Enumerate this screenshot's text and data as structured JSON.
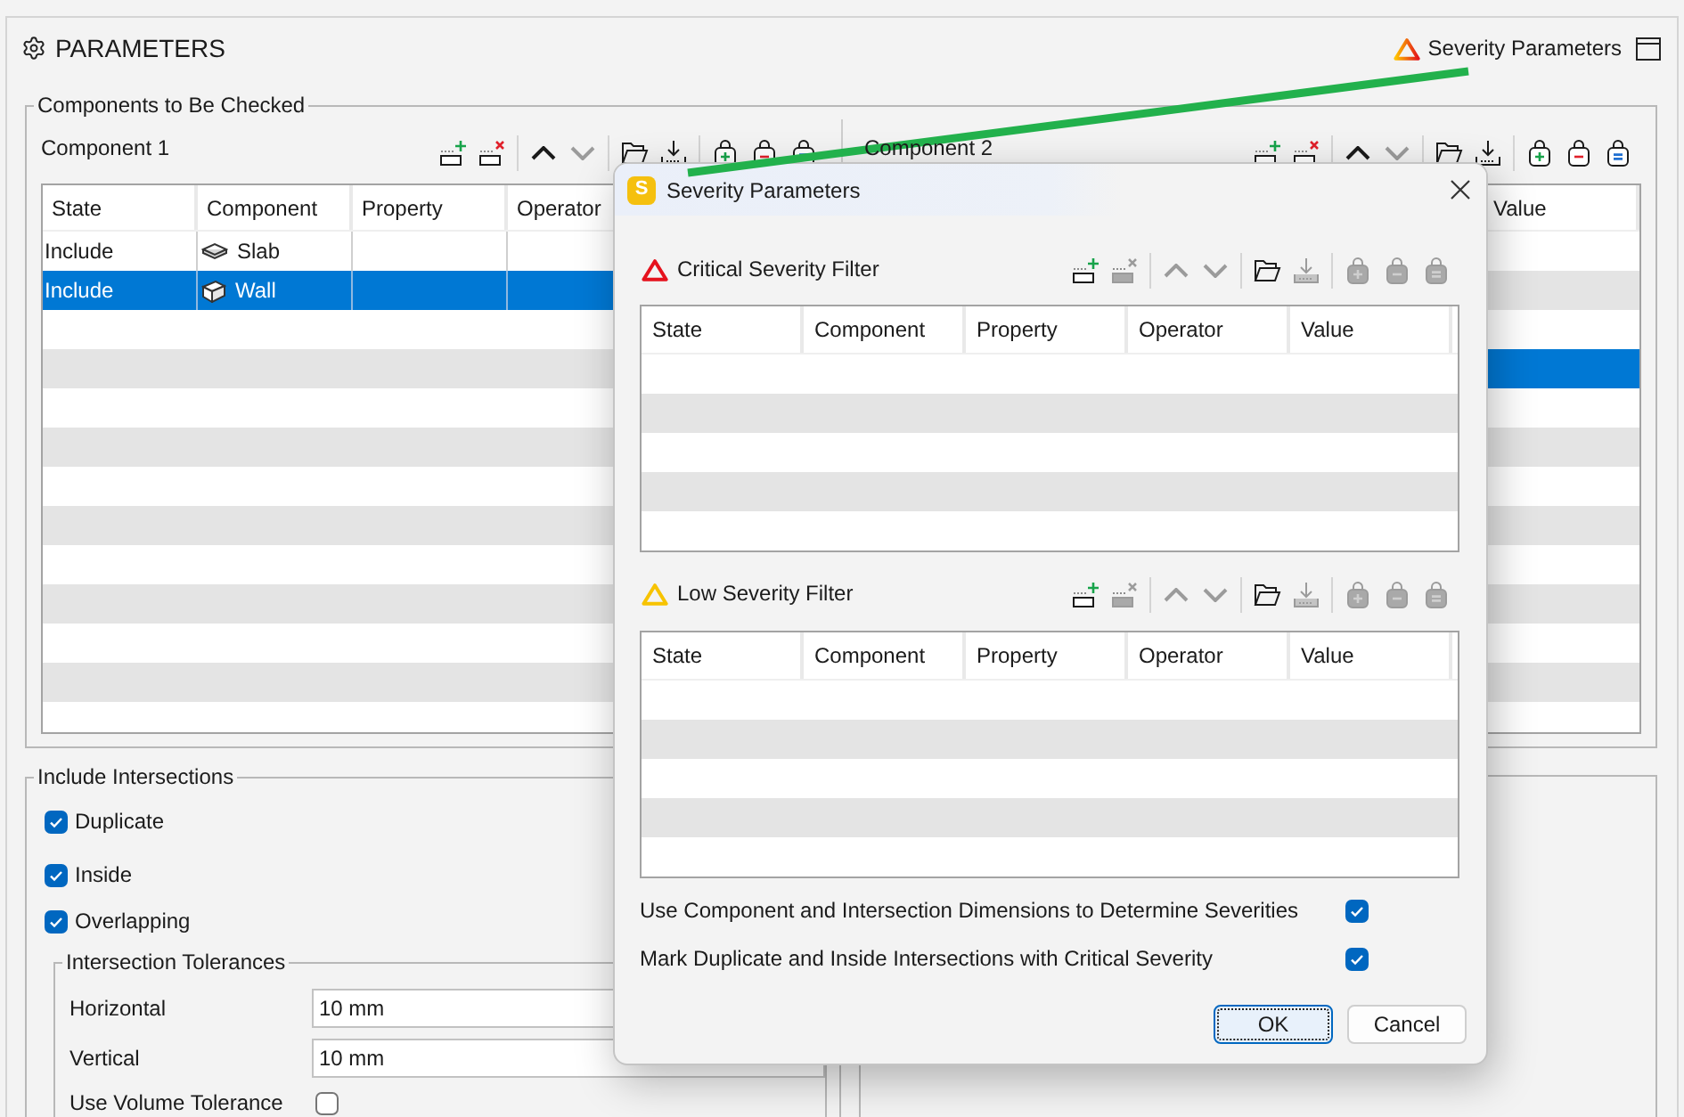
{
  "header": {
    "title": "PARAMETERS",
    "severity_button": "Severity Parameters"
  },
  "components": {
    "title": "Components to Be Checked",
    "panels": [
      {
        "label": "Component 1",
        "toolbar": [
          {
            "tools": [
              {
                "kind": "add-row",
                "disabled": false
              },
              {
                "kind": "remove-row",
                "disabled": false
              }
            ]
          },
          {
            "tools": [
              {
                "kind": "move-up",
                "disabled": false
              },
              {
                "kind": "move-down",
                "disabled": true
              }
            ]
          },
          {
            "tools": [
              {
                "kind": "open",
                "disabled": false
              },
              {
                "kind": "import",
                "disabled": false
              }
            ]
          },
          {
            "tools": [
              {
                "kind": "add-set",
                "disabled": false
              },
              {
                "kind": "remove-set",
                "disabled": false
              },
              {
                "kind": "equal-set",
                "disabled": false
              }
            ]
          }
        ],
        "columns": [
          "State",
          "Component",
          "Property",
          "Operator"
        ],
        "rows": [
          {
            "kind": "slab",
            "state": "Include",
            "component": "Slab",
            "selected": false
          },
          {
            "kind": "wall",
            "state": "Include",
            "component": "Wall",
            "selected": true
          }
        ]
      },
      {
        "label": "Component 2",
        "toolbar": [
          {
            "tools": [
              {
                "kind": "add-row",
                "disabled": false
              },
              {
                "kind": "remove-row",
                "disabled": false
              }
            ]
          },
          {
            "tools": [
              {
                "kind": "move-up",
                "disabled": false
              },
              {
                "kind": "move-down",
                "disabled": true
              }
            ]
          },
          {
            "tools": [
              {
                "kind": "open",
                "disabled": false
              },
              {
                "kind": "import",
                "disabled": false
              }
            ]
          },
          {
            "tools": [
              {
                "kind": "add-set",
                "disabled": false
              },
              {
                "kind": "remove-set",
                "disabled": false
              },
              {
                "kind": "equal-set",
                "disabled": false
              }
            ]
          }
        ],
        "columns": [
          "Value"
        ],
        "rows": [
          {
            "selected": false
          },
          {
            "selected": false
          },
          {
            "selected": false
          },
          {
            "selected": true
          }
        ]
      }
    ]
  },
  "intersections": {
    "title": "Include Intersections",
    "options": [
      {
        "label": "Duplicate",
        "checked": true
      },
      {
        "label": "Inside",
        "checked": true
      },
      {
        "label": "Overlapping",
        "checked": true
      }
    ],
    "tolerances": {
      "title": "Intersection Tolerances",
      "fields": [
        {
          "label": "Horizontal",
          "value": "10 mm"
        },
        {
          "label": "Vertical",
          "value": "10 mm"
        }
      ],
      "volume": {
        "label": "Use Volume Tolerance",
        "checked": false
      }
    }
  },
  "dialog": {
    "logo": "S",
    "title": "Severity Parameters",
    "filters": [
      {
        "title": "Critical Severity Filter",
        "color": "#e5121d",
        "toolbar": [
          {
            "tools": [
              {
                "kind": "add-row",
                "disabled": false
              },
              {
                "kind": "remove-row",
                "disabled": true
              }
            ]
          },
          {
            "tools": [
              {
                "kind": "move-up",
                "disabled": true
              },
              {
                "kind": "move-down",
                "disabled": true
              }
            ]
          },
          {
            "tools": [
              {
                "kind": "open",
                "disabled": false
              },
              {
                "kind": "import",
                "disabled": true
              }
            ]
          },
          {
            "tools": [
              {
                "kind": "add-set",
                "disabled": true
              },
              {
                "kind": "remove-set",
                "disabled": true
              },
              {
                "kind": "equal-set",
                "disabled": true
              }
            ]
          }
        ],
        "columns": [
          "State",
          "Component",
          "Property",
          "Operator",
          "Value"
        ]
      },
      {
        "title": "Low Severity Filter",
        "color": "#f7c300",
        "toolbar": [
          {
            "tools": [
              {
                "kind": "add-row",
                "disabled": false
              },
              {
                "kind": "remove-row",
                "disabled": true
              }
            ]
          },
          {
            "tools": [
              {
                "kind": "move-up",
                "disabled": true
              },
              {
                "kind": "move-down",
                "disabled": true
              }
            ]
          },
          {
            "tools": [
              {
                "kind": "open",
                "disabled": false
              },
              {
                "kind": "import",
                "disabled": true
              }
            ]
          },
          {
            "tools": [
              {
                "kind": "add-set",
                "disabled": true
              },
              {
                "kind": "remove-set",
                "disabled": true
              },
              {
                "kind": "equal-set",
                "disabled": true
              }
            ]
          }
        ],
        "columns": [
          "State",
          "Component",
          "Property",
          "Operator",
          "Value"
        ]
      }
    ],
    "options": [
      {
        "label": "Use Component and Intersection Dimensions to Determine Severities",
        "checked": true
      },
      {
        "label": "Mark Duplicate and Inside Intersections with Critical Severity",
        "checked": true
      }
    ],
    "buttons": [
      {
        "label": "OK",
        "default": true
      },
      {
        "label": "Cancel",
        "default": false
      }
    ]
  }
}
